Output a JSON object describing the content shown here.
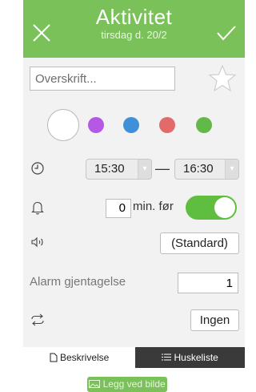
{
  "header": {
    "title": "Aktivitet",
    "subtitle": "tirsdag d. 20/2",
    "close_icon": "close-icon",
    "confirm_icon": "check-icon"
  },
  "form": {
    "title_placeholder": "Overskrift...",
    "title_value": "",
    "favorite_icon": "star-icon"
  },
  "colors": {
    "options": [
      "#ffffff",
      "#b558e6",
      "#3f90d8",
      "#e26a6a",
      "#63b84a"
    ],
    "selected": "#ffffff",
    "accent": "#7ac15a"
  },
  "time": {
    "clock_icon": "clock-icon",
    "start": "15:30",
    "separator": "—",
    "end": "16:30"
  },
  "reminder": {
    "bell_icon": "bell-icon",
    "minutes": "0",
    "suffix": "min. før",
    "enabled": true
  },
  "sound": {
    "speaker_icon": "speaker-icon",
    "value": "(Standard)"
  },
  "alarm_repeat": {
    "label": "Alarm gjentagelse",
    "value": "1"
  },
  "repeat": {
    "repeat_icon": "repeat-icon",
    "value": "Ingen"
  },
  "tabs": [
    {
      "label": "Beskrivelse",
      "icon": "document-icon",
      "active": true
    },
    {
      "label": "Huskeliste",
      "icon": "list-icon",
      "active": false
    }
  ],
  "attachment": {
    "button_label": "Legg ved bilde",
    "icon": "image-icon"
  }
}
